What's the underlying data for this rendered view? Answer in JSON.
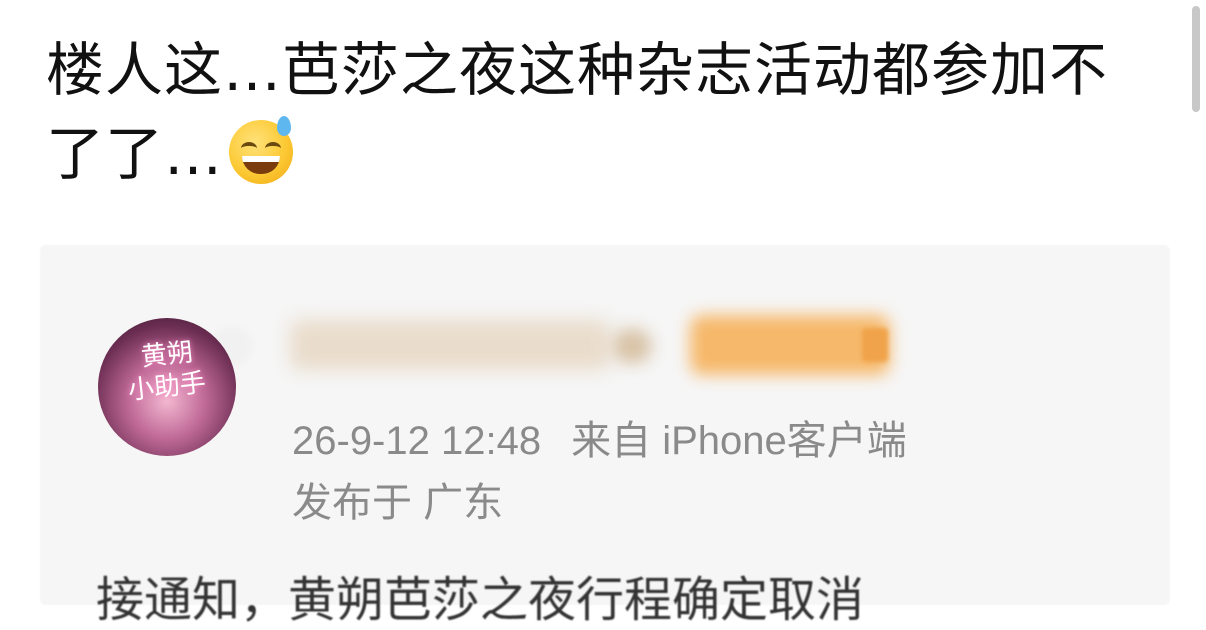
{
  "post": {
    "title": "楼人这…芭莎之夜这种杂志活动都参加不了了…",
    "emoji": "sweat-smile-emoji"
  },
  "embedded_screenshot": {
    "avatar_text_line1": "黄朔",
    "avatar_text_line2": "小助手",
    "timestamp": "26-9-12 12:48",
    "source": "来自 iPhone客户端",
    "location": "发布于 广东",
    "body_partial": "接通知，黄朔芭莎之夜行程确定取消"
  }
}
